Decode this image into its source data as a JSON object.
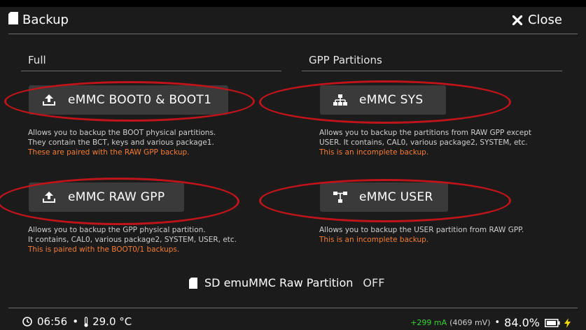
{
  "header": {
    "title": "Backup",
    "close_label": "Close"
  },
  "sections": {
    "full": {
      "title": "Full"
    },
    "gpp": {
      "title": "GPP Partitions"
    }
  },
  "buttons": {
    "boot": {
      "label": "eMMC BOOT0 & BOOT1",
      "desc1": "Allows you to backup the BOOT physical partitions.",
      "desc2": "They contain the BCT, keys and various package1.",
      "warn": "These are paired with the RAW GPP backup."
    },
    "rawgpp": {
      "label": "eMMC RAW GPP",
      "desc1": "Allows you to backup the GPP physical partition.",
      "desc2": "It contains, CAL0, various package2, SYSTEM, USER, etc.",
      "warn": "This is paired with the BOOT0/1 backups."
    },
    "sys": {
      "label": "eMMC SYS",
      "desc1": "Allows you to backup the partitions from RAW GPP except",
      "desc2": "USER. It contains, CAL0, various package2, SYSTEM, etc.",
      "warn": "This is an incomplete backup."
    },
    "user": {
      "label": "eMMC USER",
      "desc1": "Allows you to backup the USER partition from RAW GPP.",
      "warn": "This is an incomplete backup."
    }
  },
  "emummc": {
    "label": "SD emuMMC Raw Partition",
    "state": "OFF"
  },
  "footer": {
    "time": "06:56",
    "sep1": "•",
    "temp": "29.0 °C",
    "current": "+299 mA",
    "voltage": "(4069 mV)",
    "sep2": "•",
    "battery": "84.0%"
  },
  "colors": {
    "background": "#1b1b1b",
    "button": "#3a3a3a",
    "warning": "#f57c35",
    "charging": "#35d435",
    "annotation": "#c0141b"
  }
}
